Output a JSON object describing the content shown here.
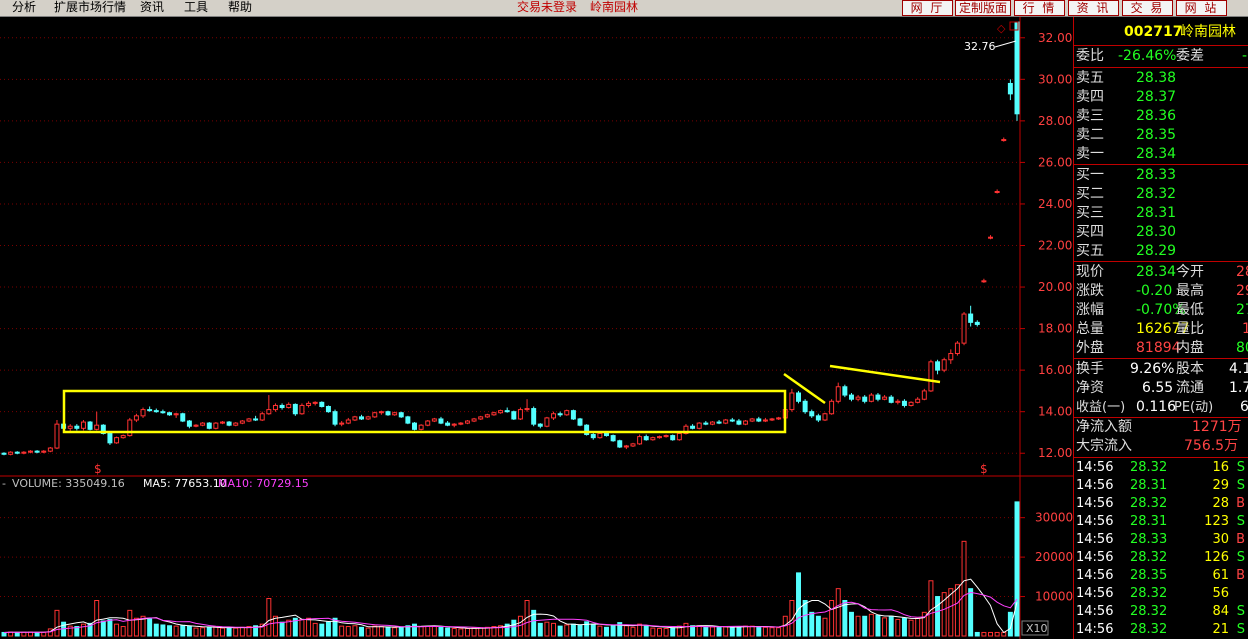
{
  "menu": {
    "items": [
      "分析",
      "扩展市场行情",
      "资讯",
      "工具",
      "帮助"
    ]
  },
  "header": {
    "login_status": "交易未登录",
    "stock_title": "岭南园林"
  },
  "top_buttons": [
    "网 厅",
    "定制版面",
    "行 情",
    "资 讯",
    "交 易",
    "网 站"
  ],
  "panel": {
    "code": "002717",
    "name": "岭南园林",
    "weibi_label": "委比",
    "weibi_value": "-26.46%",
    "weicha_label": "委差",
    "weicha_value": "-",
    "sells": [
      {
        "label": "卖五",
        "price": "28.38"
      },
      {
        "label": "卖四",
        "price": "28.37"
      },
      {
        "label": "卖三",
        "price": "28.36"
      },
      {
        "label": "卖二",
        "price": "28.35"
      },
      {
        "label": "卖一",
        "price": "28.34"
      }
    ],
    "buys": [
      {
        "label": "买一",
        "price": "28.33"
      },
      {
        "label": "买二",
        "price": "28.32"
      },
      {
        "label": "买三",
        "price": "28.31"
      },
      {
        "label": "买四",
        "price": "28.30"
      },
      {
        "label": "买五",
        "price": "28.29"
      }
    ],
    "quote": [
      {
        "l1": "现价",
        "v1": "28.34",
        "l2": "今开",
        "v2": "28"
      },
      {
        "l1": "涨跌",
        "v1": "-0.20",
        "l2": "最高",
        "v2": "29"
      },
      {
        "l1": "涨幅",
        "v1": "-0.70%",
        "l2": "最低",
        "v2": "27"
      },
      {
        "l1": "总量",
        "v1": "162677",
        "l2": "量比",
        "v2": "1"
      },
      {
        "l1": "外盘",
        "v1": "81894",
        "l2": "内盘",
        "v2": "80"
      }
    ],
    "fund": [
      {
        "l1": "换手",
        "v1": "9.26%",
        "l2": "股本",
        "v2": "4.1"
      },
      {
        "l1": "净资",
        "v1": "6.55",
        "l2": "流通",
        "v2": "1.7"
      },
      {
        "l1": "收益(一)",
        "v1": "0.116",
        "l2": "PE(动)",
        "v2": "6"
      }
    ],
    "flow": [
      {
        "label": "净流入额",
        "value": "1271万"
      },
      {
        "label": "大宗流入",
        "value": "756.5万"
      }
    ],
    "ticks": [
      {
        "time": "14:56",
        "price": "28.32",
        "vol": "16",
        "dir": "S"
      },
      {
        "time": "14:56",
        "price": "28.31",
        "vol": "29",
        "dir": "S"
      },
      {
        "time": "14:56",
        "price": "28.32",
        "vol": "28",
        "dir": "B"
      },
      {
        "time": "14:56",
        "price": "28.31",
        "vol": "123",
        "dir": "S"
      },
      {
        "time": "14:56",
        "price": "28.33",
        "vol": "30",
        "dir": "B"
      },
      {
        "time": "14:56",
        "price": "28.32",
        "vol": "126",
        "dir": "S"
      },
      {
        "time": "14:56",
        "price": "28.35",
        "vol": "61",
        "dir": "B"
      },
      {
        "time": "14:56",
        "price": "28.32",
        "vol": "56",
        "dir": ""
      },
      {
        "time": "14:56",
        "price": "28.32",
        "vol": "84",
        "dir": "S"
      },
      {
        "time": "14:56",
        "price": "28.32",
        "vol": "21",
        "dir": "S"
      }
    ]
  },
  "chart_data": {
    "type": "candlestick",
    "price_axis": {
      "ticks": [
        "12.00",
        "14.00",
        "16.00",
        "18.00",
        "20.00",
        "22.00",
        "24.00",
        "26.00",
        "28.00",
        "30.00",
        "32.00"
      ],
      "ylim": [
        11.0,
        33.0
      ]
    },
    "high_label": "32.76",
    "volume_legend": {
      "volume": "VOLUME: 335049.16",
      "ma5": "MA5: 77653.10",
      "ma10": "MA10: 70729.15"
    },
    "volume_axis": {
      "ticks": [
        "10000",
        "20000",
        "30000"
      ],
      "ylim": [
        0,
        36000
      ]
    },
    "zoom_label": "X10",
    "markers": [
      "$",
      "$"
    ],
    "colors": {
      "up": "#ff3232",
      "down": "#54ffff",
      "ma5": "#ffffff",
      "ma10": "#ff40ff",
      "annotation": "#ffff00"
    },
    "candles": [
      [
        12.0,
        12.05,
        11.9,
        11.95,
        900
      ],
      [
        11.95,
        12.1,
        11.9,
        12.05,
        1000
      ],
      [
        12.05,
        12.1,
        11.95,
        12.0,
        900
      ],
      [
        12.0,
        12.1,
        11.95,
        12.05,
        950
      ],
      [
        12.05,
        12.15,
        12.0,
        12.1,
        1000
      ],
      [
        12.1,
        12.15,
        12.0,
        12.05,
        900
      ],
      [
        12.05,
        12.15,
        12.0,
        12.1,
        950
      ],
      [
        12.1,
        12.3,
        12.05,
        12.25,
        1800
      ],
      [
        12.25,
        13.6,
        12.2,
        13.4,
        6500
      ],
      [
        13.4,
        13.5,
        13.1,
        13.2,
        3500
      ],
      [
        13.2,
        13.4,
        13.05,
        13.3,
        2500
      ],
      [
        13.3,
        13.4,
        13.1,
        13.2,
        2400
      ],
      [
        13.2,
        13.6,
        13.1,
        13.5,
        3000
      ],
      [
        13.5,
        13.55,
        13.1,
        13.15,
        3200
      ],
      [
        13.15,
        14.0,
        13.1,
        13.35,
        9000
      ],
      [
        13.35,
        13.4,
        12.9,
        12.95,
        3800
      ],
      [
        12.95,
        13.0,
        12.4,
        12.5,
        4200
      ],
      [
        12.5,
        12.8,
        12.45,
        12.75,
        3000
      ],
      [
        12.75,
        12.9,
        12.7,
        12.85,
        2400
      ],
      [
        12.85,
        13.7,
        12.8,
        13.6,
        6500
      ],
      [
        13.6,
        13.9,
        13.5,
        13.8,
        4500
      ],
      [
        13.8,
        14.2,
        13.7,
        14.1,
        5000
      ],
      [
        14.1,
        14.25,
        14.0,
        14.05,
        4300
      ],
      [
        14.05,
        14.15,
        13.95,
        14.0,
        3000
      ],
      [
        14.0,
        14.1,
        13.9,
        13.95,
        2800
      ],
      [
        13.95,
        14.0,
        13.8,
        13.85,
        2600
      ],
      [
        13.85,
        13.95,
        13.7,
        13.9,
        2500
      ],
      [
        13.9,
        13.95,
        13.5,
        13.55,
        2700
      ],
      [
        13.55,
        13.6,
        13.2,
        13.3,
        2500
      ],
      [
        13.3,
        13.4,
        13.25,
        13.35,
        2000
      ],
      [
        13.35,
        13.5,
        13.3,
        13.45,
        2100
      ],
      [
        13.45,
        13.5,
        13.15,
        13.2,
        2200
      ],
      [
        13.2,
        13.5,
        13.15,
        13.45,
        2300
      ],
      [
        13.45,
        13.55,
        13.4,
        13.5,
        2000
      ],
      [
        13.5,
        13.55,
        13.3,
        13.35,
        2100
      ],
      [
        13.35,
        13.5,
        13.3,
        13.45,
        2000
      ],
      [
        13.45,
        13.6,
        13.4,
        13.55,
        2200
      ],
      [
        13.55,
        13.7,
        13.5,
        13.65,
        2400
      ],
      [
        13.65,
        13.8,
        13.55,
        13.6,
        2600
      ],
      [
        13.6,
        14.0,
        13.55,
        13.9,
        3000
      ],
      [
        13.9,
        14.8,
        13.85,
        14.1,
        9500
      ],
      [
        14.1,
        14.4,
        14.0,
        14.3,
        5000
      ],
      [
        14.3,
        14.4,
        14.1,
        14.2,
        3500
      ],
      [
        14.2,
        14.45,
        14.15,
        14.35,
        4000
      ],
      [
        14.35,
        14.4,
        13.8,
        13.9,
        4500
      ],
      [
        13.9,
        14.4,
        13.85,
        14.3,
        4200
      ],
      [
        14.3,
        14.5,
        14.2,
        14.4,
        4500
      ],
      [
        14.4,
        14.5,
        14.3,
        14.45,
        3200
      ],
      [
        14.45,
        14.5,
        14.2,
        14.25,
        3000
      ],
      [
        14.25,
        14.3,
        13.95,
        14.0,
        3500
      ],
      [
        14.0,
        14.1,
        13.3,
        13.4,
        4500
      ],
      [
        13.4,
        13.55,
        13.3,
        13.45,
        2500
      ],
      [
        13.45,
        13.7,
        13.4,
        13.6,
        2400
      ],
      [
        13.6,
        13.8,
        13.55,
        13.75,
        2600
      ],
      [
        13.75,
        13.85,
        13.6,
        13.65,
        2200
      ],
      [
        13.65,
        13.8,
        13.6,
        13.75,
        2000
      ],
      [
        13.75,
        14.0,
        13.7,
        13.95,
        2500
      ],
      [
        13.95,
        14.05,
        13.85,
        14.0,
        2400
      ],
      [
        14.0,
        14.05,
        13.8,
        13.85,
        2300
      ],
      [
        13.85,
        14.0,
        13.8,
        13.95,
        2100
      ],
      [
        13.95,
        14.0,
        13.7,
        13.75,
        2200
      ],
      [
        13.75,
        13.8,
        13.4,
        13.45,
        2600
      ],
      [
        13.45,
        13.5,
        13.1,
        13.15,
        3000
      ],
      [
        13.15,
        13.4,
        13.1,
        13.35,
        2400
      ],
      [
        13.35,
        13.6,
        13.3,
        13.55,
        2500
      ],
      [
        13.55,
        13.7,
        13.5,
        13.65,
        2400
      ],
      [
        13.65,
        13.75,
        13.4,
        13.45,
        2300
      ],
      [
        13.45,
        13.55,
        13.3,
        13.35,
        2000
      ],
      [
        13.35,
        13.45,
        13.25,
        13.4,
        1900
      ],
      [
        13.4,
        13.5,
        13.35,
        13.45,
        1800
      ],
      [
        13.45,
        13.6,
        13.4,
        13.55,
        1900
      ],
      [
        13.55,
        13.7,
        13.5,
        13.65,
        2000
      ],
      [
        13.65,
        13.8,
        13.6,
        13.75,
        2100
      ],
      [
        13.75,
        13.9,
        13.7,
        13.85,
        2200
      ],
      [
        13.85,
        14.0,
        13.8,
        13.95,
        2400
      ],
      [
        13.95,
        14.1,
        13.9,
        14.05,
        2600
      ],
      [
        14.05,
        14.2,
        13.95,
        14.0,
        3000
      ],
      [
        14.0,
        14.05,
        13.6,
        13.65,
        4000
      ],
      [
        13.65,
        14.2,
        13.6,
        14.1,
        5000
      ],
      [
        14.1,
        14.6,
        14.0,
        14.15,
        9000
      ],
      [
        14.15,
        14.25,
        13.3,
        13.4,
        6500
      ],
      [
        13.4,
        13.45,
        13.2,
        13.3,
        3200
      ],
      [
        13.3,
        13.75,
        13.25,
        13.7,
        3500
      ],
      [
        13.7,
        14.0,
        13.6,
        13.9,
        3200
      ],
      [
        13.9,
        14.0,
        13.75,
        13.85,
        2500
      ],
      [
        13.85,
        14.1,
        13.8,
        14.05,
        2800
      ],
      [
        14.05,
        14.1,
        13.6,
        13.65,
        3000
      ],
      [
        13.65,
        13.7,
        13.3,
        13.35,
        2800
      ],
      [
        13.35,
        13.4,
        12.85,
        12.9,
        3600
      ],
      [
        12.9,
        13.0,
        12.65,
        12.75,
        3000
      ],
      [
        12.75,
        13.0,
        12.7,
        12.95,
        2500
      ],
      [
        12.95,
        13.05,
        12.8,
        12.85,
        2200
      ],
      [
        12.85,
        12.9,
        12.55,
        12.6,
        2600
      ],
      [
        12.6,
        12.65,
        12.25,
        12.3,
        3400
      ],
      [
        12.3,
        12.4,
        12.2,
        12.35,
        2600
      ],
      [
        12.35,
        12.5,
        12.3,
        12.45,
        2200
      ],
      [
        12.45,
        12.9,
        12.4,
        12.8,
        3000
      ],
      [
        12.8,
        12.9,
        12.6,
        12.65,
        2500
      ],
      [
        12.65,
        12.8,
        12.6,
        12.75,
        2000
      ],
      [
        12.75,
        12.85,
        12.7,
        12.8,
        1900
      ],
      [
        12.8,
        12.9,
        12.75,
        12.85,
        1900
      ],
      [
        12.85,
        12.9,
        12.6,
        12.65,
        2100
      ],
      [
        12.65,
        13.0,
        12.6,
        12.95,
        2500
      ],
      [
        12.95,
        13.4,
        12.9,
        13.3,
        3200
      ],
      [
        13.3,
        13.4,
        13.15,
        13.2,
        2600
      ],
      [
        13.2,
        13.5,
        13.15,
        13.45,
        2600
      ],
      [
        13.45,
        13.55,
        13.35,
        13.4,
        2300
      ],
      [
        13.4,
        13.55,
        13.35,
        13.5,
        2300
      ],
      [
        13.5,
        13.6,
        13.4,
        13.45,
        2200
      ],
      [
        13.45,
        13.65,
        13.4,
        13.6,
        2300
      ],
      [
        13.6,
        13.7,
        13.5,
        13.55,
        2200
      ],
      [
        13.55,
        13.65,
        13.35,
        13.4,
        2400
      ],
      [
        13.4,
        13.6,
        13.35,
        13.55,
        2500
      ],
      [
        13.55,
        13.7,
        13.5,
        13.65,
        2500
      ],
      [
        13.65,
        13.75,
        13.5,
        13.55,
        2400
      ],
      [
        13.55,
        13.7,
        13.5,
        13.6,
        2200
      ],
      [
        13.6,
        13.7,
        13.55,
        13.65,
        2100
      ],
      [
        13.65,
        13.75,
        13.6,
        13.7,
        2100
      ],
      [
        13.7,
        14.2,
        13.65,
        14.1,
        5000
      ],
      [
        14.1,
        15.1,
        14.0,
        14.9,
        9000
      ],
      [
        14.9,
        15.0,
        14.4,
        14.5,
        16000
      ],
      [
        14.5,
        14.6,
        13.9,
        14.0,
        9000
      ],
      [
        14.0,
        14.1,
        13.7,
        13.8,
        6000
      ],
      [
        13.8,
        13.9,
        13.5,
        13.6,
        5000
      ],
      [
        13.6,
        13.95,
        13.55,
        13.9,
        4500
      ],
      [
        13.9,
        14.6,
        13.85,
        14.5,
        9000
      ],
      [
        14.5,
        15.4,
        14.4,
        15.2,
        12000
      ],
      [
        15.2,
        15.3,
        14.7,
        14.8,
        9000
      ],
      [
        14.8,
        14.9,
        14.5,
        14.6,
        6000
      ],
      [
        14.6,
        14.8,
        14.5,
        14.7,
        5000
      ],
      [
        14.7,
        14.8,
        14.4,
        14.5,
        5000
      ],
      [
        14.5,
        14.9,
        14.45,
        14.8,
        5500
      ],
      [
        14.8,
        14.9,
        14.5,
        14.6,
        5200
      ],
      [
        14.6,
        14.8,
        14.55,
        14.7,
        4600
      ],
      [
        14.7,
        14.8,
        14.4,
        14.45,
        5000
      ],
      [
        14.45,
        14.6,
        14.35,
        14.5,
        4200
      ],
      [
        14.5,
        14.6,
        14.2,
        14.3,
        4500
      ],
      [
        14.3,
        14.5,
        14.25,
        14.45,
        4000
      ],
      [
        14.45,
        14.7,
        14.4,
        14.6,
        4500
      ],
      [
        14.6,
        15.1,
        14.55,
        15.0,
        6000
      ],
      [
        15.0,
        16.5,
        14.95,
        16.4,
        14000
      ],
      [
        16.4,
        16.5,
        15.8,
        16.0,
        10000
      ],
      [
        16.0,
        16.6,
        15.9,
        16.5,
        11000
      ],
      [
        16.5,
        17.0,
        16.3,
        16.8,
        12000
      ],
      [
        16.8,
        17.4,
        16.7,
        17.3,
        13000
      ],
      [
        17.3,
        18.8,
        17.2,
        18.7,
        24000
      ],
      [
        18.7,
        19.1,
        18.1,
        18.3,
        12000
      ],
      [
        18.3,
        18.4,
        18.1,
        18.2,
        900
      ],
      [
        20.3,
        20.4,
        20.2,
        20.3,
        900
      ],
      [
        22.4,
        22.5,
        22.3,
        22.4,
        900
      ],
      [
        24.6,
        24.7,
        24.5,
        24.6,
        900
      ],
      [
        27.1,
        27.2,
        27.0,
        27.1,
        900
      ],
      [
        29.8,
        30.0,
        29.0,
        29.3,
        6000
      ],
      [
        32.76,
        32.76,
        28.0,
        28.34,
        34000
      ]
    ]
  }
}
